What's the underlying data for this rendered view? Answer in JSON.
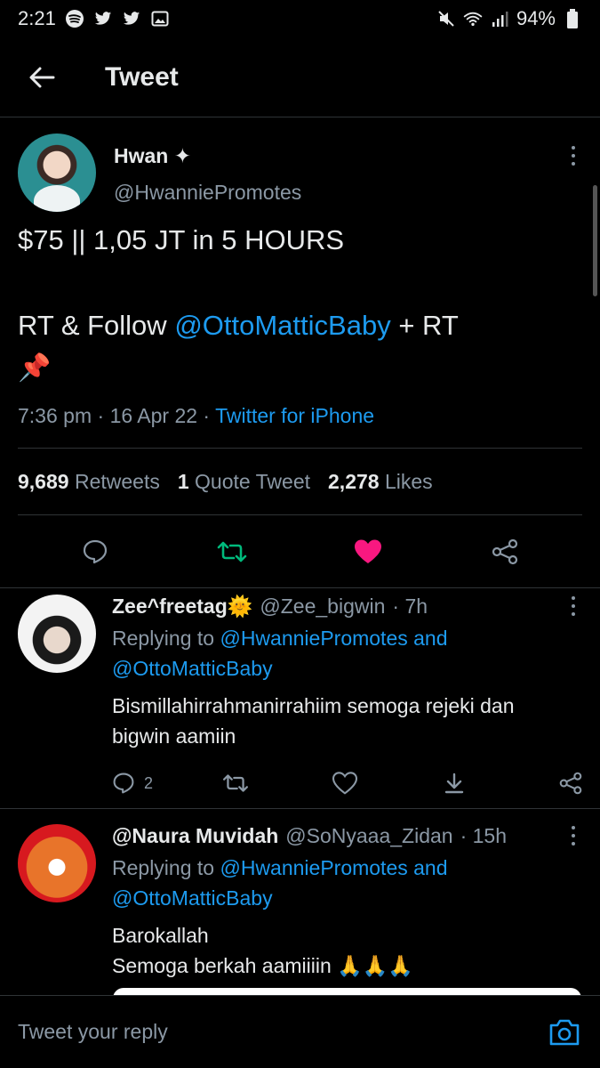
{
  "status_bar": {
    "time": "2:21",
    "battery": "94%"
  },
  "header": {
    "title": "Tweet"
  },
  "tweet": {
    "display_name": "Hwan ✦",
    "handle": "@HwanniePromotes",
    "line1": "$75 || 1,05 JT in 5 HOURS",
    "line2_prefix": "RT & Follow ",
    "line2_mention": "@OttoMatticBaby",
    "line2_suffix": " + RT",
    "line3": "📌",
    "time": "7:36 pm",
    "date": "16 Apr 22",
    "source": "Twitter for iPhone",
    "retweets_count": "9,689",
    "retweets_label": "Retweets",
    "quotes_count": "1",
    "quotes_label": "Quote Tweet",
    "likes_count": "2,278",
    "likes_label": "Likes"
  },
  "replies": [
    {
      "display_name": "Zee^freetag🌞",
      "handle": "@Zee_bigwin",
      "age": "· 7h",
      "replying_prefix": "Replying to ",
      "replying_to_1": "@HwanniePromotes",
      "replying_and": " and",
      "replying_to_2": "@OttoMatticBaby",
      "text": "Bismillahirrahmanirrahiim semoga rejeki dan bigwin aamiin",
      "reply_count": "2"
    },
    {
      "display_name": "@Naura Muvidah",
      "handle": "@SoNyaaa_Zidan",
      "age": "· 15h",
      "replying_prefix": "Replying to ",
      "replying_to_1": "@HwanniePromotes",
      "replying_and": " and",
      "replying_to_2": "@OttoMatticBaby",
      "text_line1": "Barokallah",
      "text_line2": "Semoga berkah aamiiiin 🙏🙏🙏"
    }
  ],
  "compose": {
    "placeholder": "Tweet your reply"
  },
  "colors": {
    "accent": "#1d9bf0",
    "like": "#f91880",
    "retweet": "#00ba7c",
    "muted": "#8b98a5"
  }
}
